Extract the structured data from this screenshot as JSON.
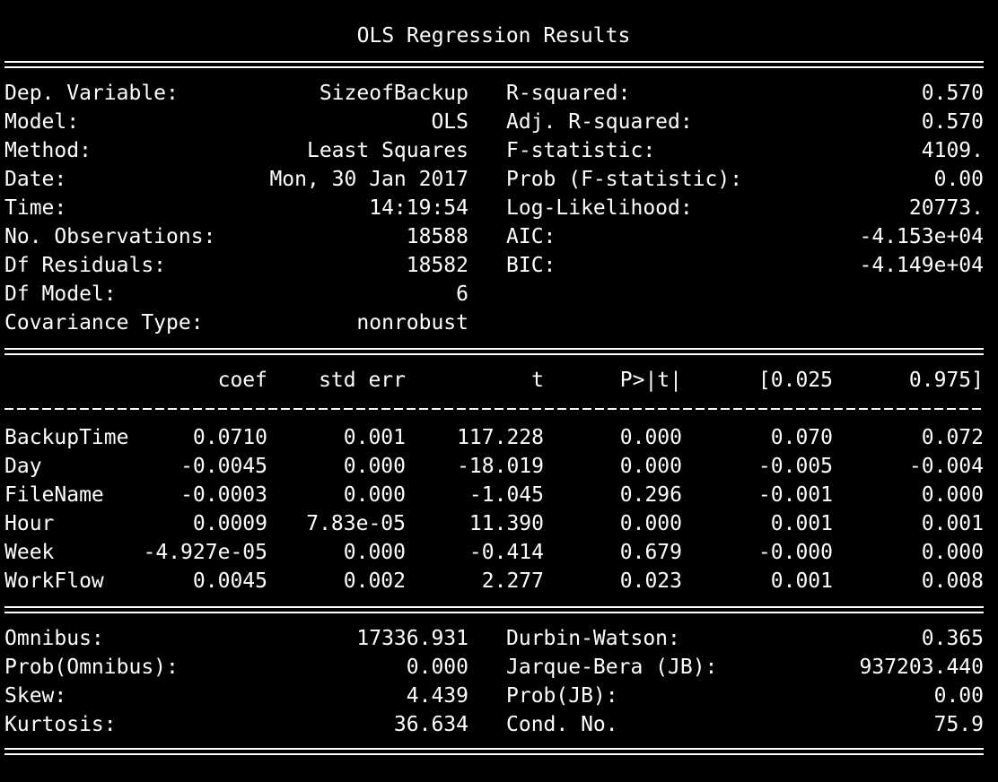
{
  "title": "OLS Regression Results",
  "model_info": {
    "left": [
      {
        "label": "Dep. Variable:",
        "value": "SizeofBackup"
      },
      {
        "label": "Model:",
        "value": "OLS"
      },
      {
        "label": "Method:",
        "value": "Least Squares"
      },
      {
        "label": "Date:",
        "value": "Mon, 30 Jan 2017"
      },
      {
        "label": "Time:",
        "value": "14:19:54"
      },
      {
        "label": "No. Observations:",
        "value": "18588"
      },
      {
        "label": "Df Residuals:",
        "value": "18582"
      },
      {
        "label": "Df Model:",
        "value": "6"
      },
      {
        "label": "Covariance Type:",
        "value": "nonrobust"
      }
    ],
    "right": [
      {
        "label": "R-squared:",
        "value": "0.570"
      },
      {
        "label": "Adj. R-squared:",
        "value": "0.570"
      },
      {
        "label": "F-statistic:",
        "value": "4109."
      },
      {
        "label": "Prob (F-statistic):",
        "value": "0.00"
      },
      {
        "label": "Log-Likelihood:",
        "value": "20773."
      },
      {
        "label": "AIC:",
        "value": "-4.153e+04"
      },
      {
        "label": "BIC:",
        "value": "-4.149e+04"
      }
    ]
  },
  "coef_table": {
    "headers": [
      "coef",
      "std err",
      "t",
      "P>|t|",
      "[0.025",
      "0.975]"
    ],
    "rows": [
      {
        "name": "BackupTime",
        "values": [
          "0.0710",
          "0.001",
          "117.228",
          "0.000",
          "0.070",
          "0.072"
        ]
      },
      {
        "name": "Day",
        "values": [
          "-0.0045",
          "0.000",
          "-18.019",
          "0.000",
          "-0.005",
          "-0.004"
        ]
      },
      {
        "name": "FileName",
        "values": [
          "-0.0003",
          "0.000",
          "-1.045",
          "0.296",
          "-0.001",
          "0.000"
        ]
      },
      {
        "name": "Hour",
        "values": [
          "0.0009",
          "7.83e-05",
          "11.390",
          "0.000",
          "0.001",
          "0.001"
        ]
      },
      {
        "name": "Week",
        "values": [
          "-4.927e-05",
          "0.000",
          "-0.414",
          "0.679",
          "-0.000",
          "0.000"
        ]
      },
      {
        "name": "WorkFlow",
        "values": [
          "0.0045",
          "0.002",
          "2.277",
          "0.023",
          "0.001",
          "0.008"
        ]
      }
    ]
  },
  "diagnostics": {
    "left": [
      {
        "label": "Omnibus:",
        "value": "17336.931"
      },
      {
        "label": "Prob(Omnibus):",
        "value": "0.000"
      },
      {
        "label": "Skew:",
        "value": "4.439"
      },
      {
        "label": "Kurtosis:",
        "value": "36.634"
      }
    ],
    "right": [
      {
        "label": "Durbin-Watson:",
        "value": "0.365"
      },
      {
        "label": "Jarque-Bera (JB):",
        "value": "937203.440"
      },
      {
        "label": "Prob(JB):",
        "value": "0.00"
      },
      {
        "label": "Cond. No.",
        "value": "75.9"
      }
    ]
  }
}
